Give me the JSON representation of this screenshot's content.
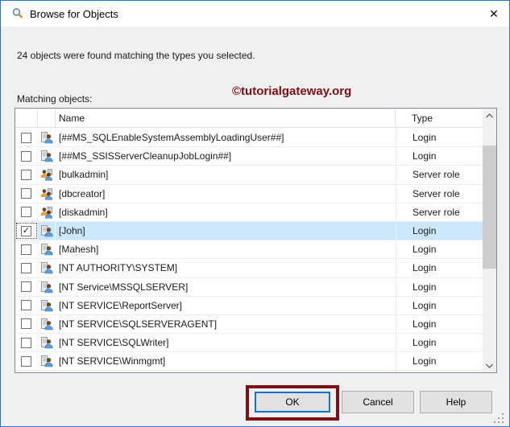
{
  "window": {
    "title": "Browse for Objects",
    "close_glyph": "✕"
  },
  "message": "24 objects were found matching the types you selected.",
  "matching_objects_label": "Matching objects:",
  "watermark": "©tutorialgateway.org",
  "table": {
    "header": {
      "name": "Name",
      "type": "Type"
    },
    "rows": [
      {
        "name": "[##MS_SQLEnableSystemAssemblyLoadingUser##]",
        "type": "Login",
        "icon": "login",
        "checked": false,
        "selected": false
      },
      {
        "name": "[##MS_SSISServerCleanupJobLogin##]",
        "type": "Login",
        "icon": "login",
        "checked": false,
        "selected": false
      },
      {
        "name": "[bulkadmin]",
        "type": "Server role",
        "icon": "server-role",
        "checked": false,
        "selected": false
      },
      {
        "name": "[dbcreator]",
        "type": "Server role",
        "icon": "server-role",
        "checked": false,
        "selected": false
      },
      {
        "name": "[diskadmin]",
        "type": "Server role",
        "icon": "server-role",
        "checked": false,
        "selected": false
      },
      {
        "name": "[John]",
        "type": "Login",
        "icon": "login",
        "checked": true,
        "selected": true
      },
      {
        "name": "[Mahesh]",
        "type": "Login",
        "icon": "login",
        "checked": false,
        "selected": false
      },
      {
        "name": "[NT AUTHORITY\\SYSTEM]",
        "type": "Login",
        "icon": "login",
        "checked": false,
        "selected": false
      },
      {
        "name": "[NT Service\\MSSQLSERVER]",
        "type": "Login",
        "icon": "login",
        "checked": false,
        "selected": false
      },
      {
        "name": "[NT SERVICE\\ReportServer]",
        "type": "Login",
        "icon": "login",
        "checked": false,
        "selected": false
      },
      {
        "name": "[NT SERVICE\\SQLSERVERAGENT]",
        "type": "Login",
        "icon": "login",
        "checked": false,
        "selected": false
      },
      {
        "name": "[NT SERVICE\\SQLWriter]",
        "type": "Login",
        "icon": "login",
        "checked": false,
        "selected": false
      },
      {
        "name": "[NT SERVICE\\Winmgmt]",
        "type": "Login",
        "icon": "login",
        "checked": false,
        "selected": false
      },
      {
        "name": "",
        "type": "",
        "icon": "login",
        "checked": false,
        "selected": false
      }
    ]
  },
  "buttons": {
    "ok": "OK",
    "cancel": "Cancel",
    "help": "Help"
  },
  "glyphs": {
    "check": "✓"
  },
  "colors": {
    "window_border": "#2577c8",
    "selection": "#cbe8fc",
    "annotation_box": "#7b1113",
    "watermark_text": "#7d0d12",
    "ok_focus_border": "#0f74cf"
  }
}
